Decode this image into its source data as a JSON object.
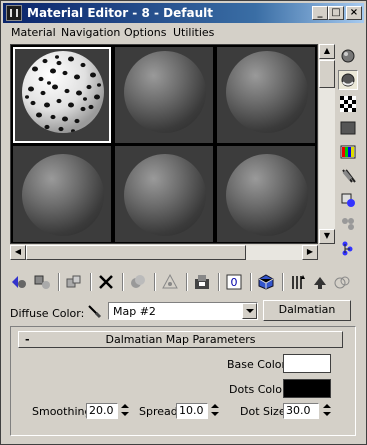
{
  "window": {
    "title": "Material Editor - 8 - Default",
    "controls": [
      "_",
      "□",
      "×"
    ]
  },
  "menu": [
    {
      "label": "Material",
      "access": "M"
    },
    {
      "label": "Navigation",
      "access": "N"
    },
    {
      "label": "Options",
      "access": "O"
    },
    {
      "label": "Utilities",
      "access": "U"
    }
  ],
  "slots": {
    "active_index": 0,
    "active_material": "dalmatian-spots",
    "count": 6
  },
  "side_tools": [
    "sample-type-icon",
    "backlight-icon",
    "background-checker-icon",
    "uv-tiling-icon",
    "video-color-check-icon",
    "make-preview-icon",
    "options-icon",
    "select-by-material-icon",
    "material-map-navigator-icon"
  ],
  "bottom_tools": [
    "get-material-icon",
    "put-to-scene-icon",
    "assign-to-selection-icon",
    "reset-map-icon",
    "make-unique-icon",
    "put-to-library-icon",
    "material-id-channel-icon",
    "show-map-in-viewport-icon",
    "show-end-result-icon",
    "go-to-parent-icon",
    "go-forward-to-sibling-icon"
  ],
  "diffuse": {
    "label": "Diffuse Color:",
    "map_value": "Map #2",
    "type_button": "Dalmatian"
  },
  "rollout": {
    "toggle": "-",
    "title": "Dalmatian Map Parameters",
    "base_color_label": "Base Color",
    "base_color": "#ffffff",
    "dots_color_label": "Dots Color",
    "dots_color": "#000000",
    "smoothing_label": "Smoothing",
    "smoothing_value": "20.0",
    "spread_label": "Spread",
    "spread_value": "10.0",
    "dot_size_label": "Dot Size",
    "dot_size_value": "30.0"
  },
  "colors": {
    "titlebar_start": "#0a246a",
    "titlebar_end": "#a6caf0",
    "panel_bg": "#d4d0c8",
    "slot_bg": "#3c3c3c"
  }
}
